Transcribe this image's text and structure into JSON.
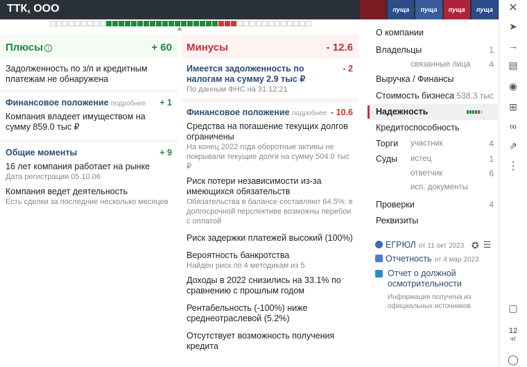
{
  "header": {
    "title": "ТТК, ООО",
    "banner_text": "пуща"
  },
  "scale": {
    "green_from": 10,
    "green_to": 27,
    "red_from": 28,
    "red_to": 30,
    "total": 42
  },
  "plus": {
    "title": "Плюсы",
    "total": "+ 60",
    "intro": "Задолженность по з/п и кредитным платежам не обнаружена",
    "fin": {
      "title": "Финансовое положение",
      "more": "подробнее",
      "value": "+ 1",
      "text": "Компания владеет имуществом на сумму 859.0 тыс ₽"
    },
    "general": {
      "title": "Общие моменты",
      "value": "+ 9",
      "items": [
        {
          "text": "16 лет компания работает на рынке",
          "sub": "Дата регистрации 05.10.06"
        },
        {
          "text": "Компания ведет деятельность",
          "sub": "Есть сделки за последние несколько месяцев"
        }
      ]
    }
  },
  "minus": {
    "title": "Минусы",
    "total": "- 12.6",
    "tax": {
      "text": "Имеется задолженность по налогам на сумму 2.9 тыс ₽",
      "value": "- 2",
      "sub": "По данным ФНС на 31.12.21"
    },
    "fin": {
      "title": "Финансовое положение",
      "more": "подробнее",
      "value": "- 10.6"
    },
    "items": [
      {
        "text": "Средства на погашение текущих долгов ограничены",
        "sub": "На конец 2022 года оборотные активы не покрывали текущие долги на сумму 504.0 тыс ₽"
      },
      {
        "text": "Риск потери независимости из-за имеющихся обязательств",
        "sub": "Обязательства в балансе составляют 64.5%: в долгосрочной перспективе возможны перебои с оплатой"
      },
      {
        "text": "Риск задержки платежей высокий (100%)",
        "sub": ""
      },
      {
        "text": "Вероятность банкротства",
        "sub": "Найден риск по 4 методикам из 5"
      },
      {
        "text": "Доходы в 2022 снизились на 33.1% по сравнению с прошлым годом",
        "sub": ""
      },
      {
        "text": "Рентабельность (-100%) ниже среднеотраслевой (5.2%)",
        "sub": ""
      },
      {
        "text": "Отсутствует возможность получения кредита",
        "sub": ""
      }
    ]
  },
  "nav": {
    "about": "О компании",
    "owners": "Владельцы",
    "owners_count": "1",
    "related": "связанные лица",
    "related_count": "4",
    "revenue": "Выручка / Финансы",
    "value": "Стоимость бизнеса",
    "value_amount": "538.3 тыс",
    "reliability": "Надежность",
    "credit": "Кредитоспособность",
    "tenders": "Торги",
    "tenders_sub": "участник",
    "tenders_count": "4",
    "courts": "Суды",
    "plaintiff": "истец",
    "plaintiff_count": "1",
    "defendant": "ответчик",
    "defendant_count": "6",
    "enforcement": "исп. документы",
    "checks": "Проверки",
    "checks_count": "4",
    "requisites": "Реквизиты"
  },
  "docs": {
    "egrul": "ЕГРЮЛ",
    "egrul_date": "от 11 окт 2023",
    "report": "Отчетность",
    "report_date": "от 4 мар 2023",
    "reliability_report": "Отчет о должной осмотрительности",
    "note": "Информация получена из официальных источников"
  },
  "side": {
    "clock_time": "12",
    "clock_day": "чт"
  }
}
